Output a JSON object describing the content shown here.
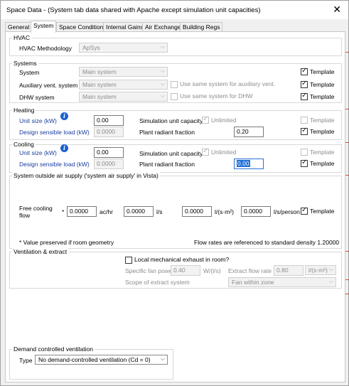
{
  "window": {
    "title": "Space Data - (System tab data shared with Apache except simulation unit capacities)",
    "close": "✕"
  },
  "tabs": [
    "General",
    "System",
    "Space Conditions",
    "Internal Gains",
    "Air Exchange",
    "Building Regs"
  ],
  "hvac": {
    "group": "HVAC",
    "methodology_label": "HVAC Methodology",
    "methodology_value": "ApSys"
  },
  "systems": {
    "group": "Systems",
    "system_label": "System",
    "system_value": "Main system",
    "aux_label": "Auxiliary vent. system",
    "aux_value": "Main system",
    "aux_same": "Use same system for auxiliary vent.",
    "dhw_label": "DHW system",
    "dhw_value": "Main system",
    "dhw_same": "Use same system for DHW",
    "template": "Template"
  },
  "heating": {
    "group": "Heating",
    "unit_size_label": "Unit size (kW)",
    "unit_size_value": "0.00",
    "design_load_label": "Design sensible load (kW)",
    "design_load_value": "0.0000",
    "sim_capacity_label": "Simulation unit capacity",
    "unlimited": "Unlimited",
    "radiant_label": "Plant radiant fraction",
    "radiant_value": "0.20",
    "template": "Template"
  },
  "cooling": {
    "group": "Cooling",
    "unit_size_label": "Unit size (kW)",
    "unit_size_value": "0.00",
    "design_load_label": "Design sensible load (kW)",
    "design_load_value": "0.0000",
    "sim_capacity_label": "Simulation unit capacity",
    "unlimited": "Unlimited",
    "radiant_label": "Plant radiant fraction",
    "radiant_value": "0.00",
    "template": "Template"
  },
  "outside_air": {
    "group": "System outside air supply ('system air supply' in Vista)",
    "free_cooling_label": "Free cooling flow",
    "asterisk": "*",
    "v1": "0.0000",
    "u1": "ac/hr",
    "v2": "0.0000",
    "u2": "l/s",
    "v3": "0.0000",
    "u3": "l/(s·m²)",
    "v4": "0.0000",
    "u4": "l/s/person",
    "template": "Template",
    "note_left": "* Value preserved if room geometry",
    "note_right": "Flow rates are referenced to standard density 1.20000"
  },
  "ventilation": {
    "group": "Ventilation & extract",
    "local_exhaust": "Local mechanical exhaust in room?",
    "fan_power_label": "Specific fan power",
    "fan_power_value": "0.40",
    "fan_power_unit": "W/(l/s)",
    "extract_rate_label": "Extract flow rate",
    "extract_rate_value": "0.80",
    "extract_rate_unit": "l/(s·m²)",
    "scope_label": "Scope of extract system",
    "scope_value": "Fan within zone"
  },
  "dcv": {
    "group": "Demand controlled ventilation",
    "type_label": "Type",
    "type_value": "No demand-controlled ventilation (Cd = 0)"
  },
  "icons": {
    "info": "info-icon",
    "check": "check-icon",
    "dropdown": "chevron-down-icon",
    "close": "close-icon"
  }
}
